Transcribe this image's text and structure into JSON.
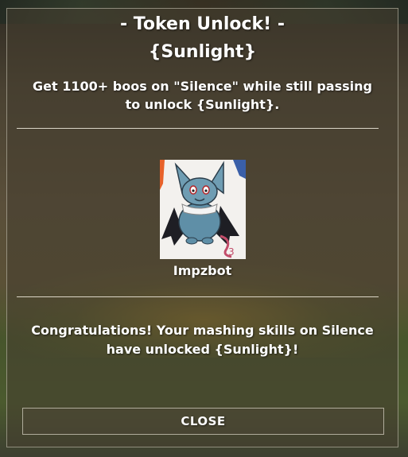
{
  "dialog": {
    "title": "- Token Unlock! -",
    "token_name": "{Sunlight}",
    "description": "Get 1100+ boos on \"Silence\" while still passing to unlock {Sunlight}.",
    "portrait": {
      "icon": "impzbot-portrait-image",
      "name": "Impzbot"
    },
    "message": "Congratulations!  Your mashing skills on Silence have unlocked {Sunlight}!",
    "close_label": "CLOSE"
  }
}
